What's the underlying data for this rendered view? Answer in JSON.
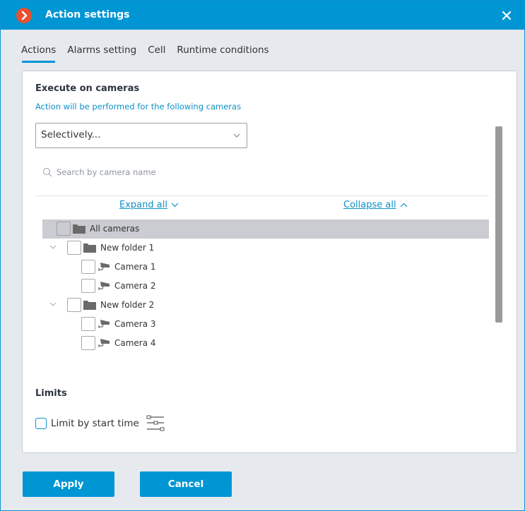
{
  "window": {
    "title": "Action settings",
    "logo_icon": "chevron-right-logo",
    "close_icon": "close-icon"
  },
  "tabs": [
    {
      "label": "Actions",
      "active": true
    },
    {
      "label": "Alarms setting",
      "active": false
    },
    {
      "label": "Cell",
      "active": false
    },
    {
      "label": "Runtime conditions",
      "active": false
    }
  ],
  "execute": {
    "title": "Execute on cameras",
    "hint": "Action will be performed for the following cameras",
    "mode_select": {
      "value": "Selectively..."
    },
    "search": {
      "placeholder": "Search by camera name",
      "value": ""
    },
    "expand_all": "Expand all",
    "collapse_all": "Collapse all",
    "tree": [
      {
        "label": "All cameras",
        "type": "folder",
        "level": 0,
        "checked": false,
        "selected": true,
        "expander": false
      },
      {
        "label": "New folder 1",
        "type": "folder",
        "level": 1,
        "checked": false,
        "selected": false,
        "expander": true
      },
      {
        "label": "Camera 1",
        "type": "camera",
        "level": 2,
        "checked": false,
        "selected": false,
        "expander": false
      },
      {
        "label": "Camera 2",
        "type": "camera",
        "level": 2,
        "checked": false,
        "selected": false,
        "expander": false
      },
      {
        "label": "New folder 2",
        "type": "folder",
        "level": 1,
        "checked": false,
        "selected": false,
        "expander": true
      },
      {
        "label": "Camera 3",
        "type": "camera",
        "level": 2,
        "checked": false,
        "selected": false,
        "expander": false
      },
      {
        "label": "Camera 4",
        "type": "camera",
        "level": 2,
        "checked": false,
        "selected": false,
        "expander": false
      }
    ]
  },
  "limits": {
    "title": "Limits",
    "limit_by_start_time": {
      "label": "Limit by start time",
      "checked": false
    }
  },
  "footer": {
    "apply": "Apply",
    "cancel": "Cancel"
  },
  "colors": {
    "accent": "#0096d4",
    "logo": "#e8502f",
    "selected_row": "#cbccd1"
  }
}
